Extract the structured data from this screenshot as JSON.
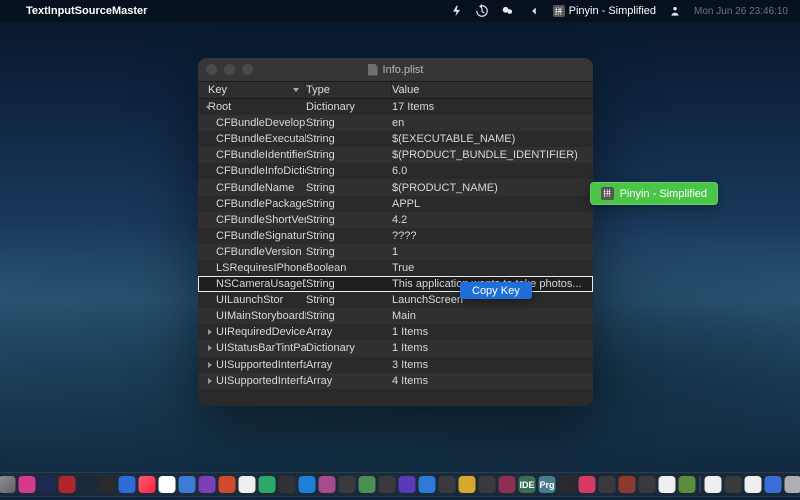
{
  "menubar": {
    "appName": "TextInputSourceMaster",
    "inputMethod": "Pinyin - Simplified",
    "clock": "Mon Jun 26  23:46:10"
  },
  "window": {
    "title": "Info.plist",
    "columns": {
      "key": "Key",
      "type": "Type",
      "value": "Value"
    },
    "rows": [
      {
        "k": "Root",
        "t": "Dictionary",
        "v": "17 Items",
        "indent": "root",
        "exp": true
      },
      {
        "k": "CFBundleDevelopmentRegion",
        "t": "String",
        "v": "en",
        "indent": "i1"
      },
      {
        "k": "CFBundleExecutable",
        "t": "String",
        "v": "$(EXECUTABLE_NAME)",
        "indent": "i1"
      },
      {
        "k": "CFBundleIdentifier",
        "t": "String",
        "v": "$(PRODUCT_BUNDLE_IDENTIFIER)",
        "indent": "i1"
      },
      {
        "k": "CFBundleInfoDictionaryVersion",
        "t": "String",
        "v": "6.0",
        "indent": "i1"
      },
      {
        "k": "CFBundleName",
        "t": "String",
        "v": "$(PRODUCT_NAME)",
        "indent": "i1"
      },
      {
        "k": "CFBundlePackageType",
        "t": "String",
        "v": "APPL",
        "indent": "i1"
      },
      {
        "k": "CFBundleShortVersionString",
        "t": "String",
        "v": "4.2",
        "indent": "i1"
      },
      {
        "k": "CFBundleSignature",
        "t": "String",
        "v": "????",
        "indent": "i1"
      },
      {
        "k": "CFBundleVersion",
        "t": "String",
        "v": "1",
        "indent": "i1"
      },
      {
        "k": "LSRequiresIPhoneOS",
        "t": "Boolean",
        "v": "True",
        "indent": "i1"
      },
      {
        "k": "NSCameraUsageDescription",
        "t": "String",
        "v": "This application wants to take photos...",
        "indent": "i1",
        "sel": true
      },
      {
        "k": "UILaunchStor",
        "t": "String",
        "v": "LaunchScreen",
        "indent": "i1"
      },
      {
        "k": "UIMainStoryboardFile",
        "t": "String",
        "v": "Main",
        "indent": "i1"
      },
      {
        "k": "UIRequiredDeviceCapabilities",
        "t": "Array",
        "v": "1 Items",
        "indent": "i1",
        "col": true
      },
      {
        "k": "UIStatusBarTintParameters",
        "t": "Dictionary",
        "v": "1 Items",
        "indent": "i1",
        "col": true
      },
      {
        "k": "UISupportedInterfaceOrientations",
        "t": "Array",
        "v": "3 Items",
        "indent": "i1",
        "col": true
      },
      {
        "k": "UISupportedInterfaceOrientation...",
        "t": "Array",
        "v": "4 Items",
        "indent": "i1",
        "col": true
      }
    ]
  },
  "contextMenu": {
    "label": "Copy Key"
  },
  "floatBadge": {
    "label": "Pinyin - Simplified"
  },
  "dock": [
    {
      "name": "finder",
      "bg": "linear-gradient(135deg,#1ba7f0,#0d7ad8)"
    },
    {
      "name": "launchpad",
      "bg": "linear-gradient(135deg,#8e8e93,#636366)"
    },
    {
      "name": "app1",
      "bg": "#d63a8e"
    },
    {
      "name": "app2",
      "bg": "#1e2a52"
    },
    {
      "name": "app3",
      "bg": "#b0252e"
    },
    {
      "name": "steam",
      "bg": "#1b2838"
    },
    {
      "name": "app5",
      "bg": "#2a2a2e"
    },
    {
      "name": "bluething",
      "bg": "#2e6bd6"
    },
    {
      "name": "music",
      "bg": "linear-gradient(135deg,#fb5c74,#fa233b)"
    },
    {
      "name": "app7",
      "bg": "#fff"
    },
    {
      "name": "app8",
      "bg": "#3b7cd6"
    },
    {
      "name": "app9",
      "bg": "#7b3fb8"
    },
    {
      "name": "app10",
      "bg": "#d04a2e"
    },
    {
      "name": "app11",
      "bg": "#efefef"
    },
    {
      "name": "app12",
      "bg": "#2ea865"
    },
    {
      "name": "app13",
      "bg": "#323236"
    },
    {
      "name": "app14",
      "bg": "#1e7fd6"
    },
    {
      "name": "app15",
      "bg": "#a84a8e"
    },
    {
      "name": "app16",
      "bg": "#3a3a3e"
    },
    {
      "name": "app17",
      "bg": "#4a8e52"
    },
    {
      "name": "app18",
      "bg": "#3a3a3e"
    },
    {
      "name": "app19",
      "bg": "#5a3ab8"
    },
    {
      "name": "app20",
      "bg": "#2e7ad6"
    },
    {
      "name": "app21",
      "bg": "#3a3a3e"
    },
    {
      "name": "app22",
      "bg": "#d6a82e"
    },
    {
      "name": "app23",
      "bg": "#3a3a3e"
    },
    {
      "name": "app24",
      "bg": "#8e2e52"
    },
    {
      "name": "ide",
      "bg": "#3a6e52",
      "txt": "IDE"
    },
    {
      "name": "prg",
      "bg": "#4a7a8e",
      "txt": "Prg"
    },
    {
      "name": "app25",
      "bg": "#2a2a2e"
    },
    {
      "name": "app26",
      "bg": "#d63a62"
    },
    {
      "name": "app27",
      "bg": "#3a3a3e"
    },
    {
      "name": "app28",
      "bg": "#8e3a2e"
    },
    {
      "name": "app29",
      "bg": "#3a3a3e"
    },
    {
      "name": "app30",
      "bg": "#efefef"
    },
    {
      "name": "app31",
      "bg": "#5a8e3a"
    },
    {
      "sep": true
    },
    {
      "name": "app32",
      "bg": "#efefef"
    },
    {
      "name": "app33",
      "bg": "#3a3a3e"
    },
    {
      "name": "app34",
      "bg": "#efefef"
    },
    {
      "name": "app35",
      "bg": "#3a6ed6"
    },
    {
      "name": "app36",
      "bg": "#aeaeb2"
    },
    {
      "name": "trash",
      "bg": "#48484c"
    }
  ]
}
